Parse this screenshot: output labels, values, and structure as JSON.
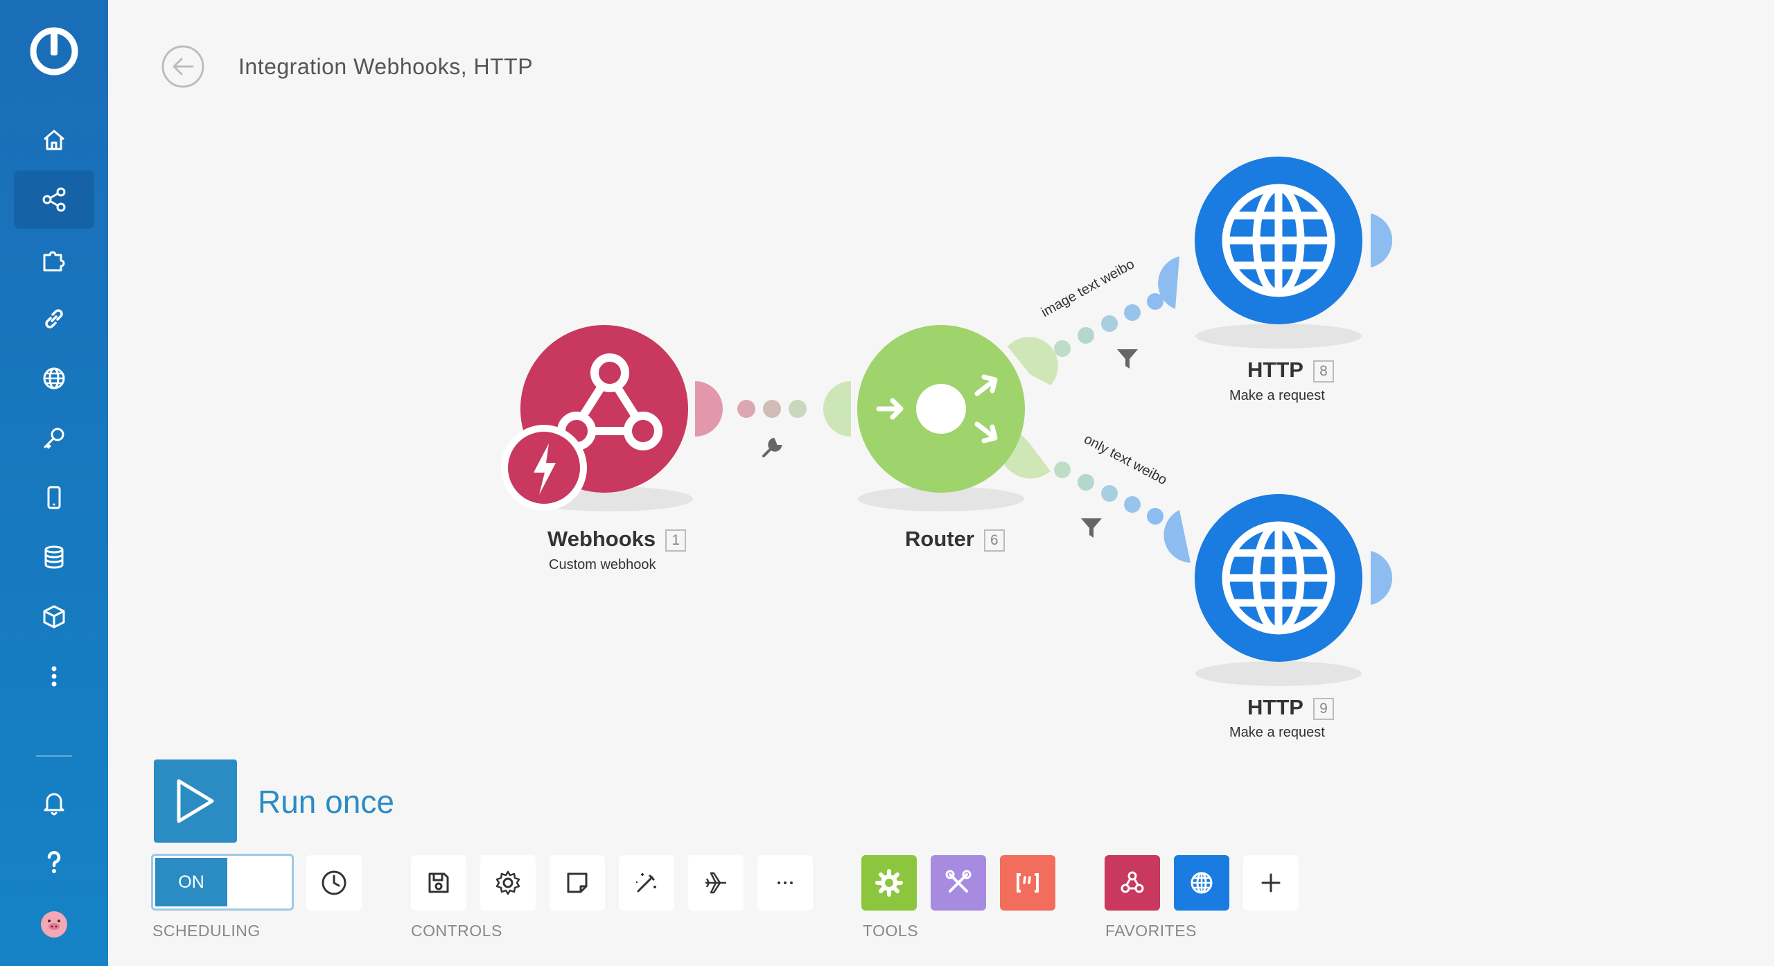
{
  "header": {
    "title": "Integration Webhooks, HTTP"
  },
  "sidebar": {
    "items": [
      {
        "icon": "home-icon"
      },
      {
        "icon": "share-icon"
      },
      {
        "icon": "puzzle-icon"
      },
      {
        "icon": "link-icon"
      },
      {
        "icon": "globe-icon"
      },
      {
        "icon": "key-icon"
      },
      {
        "icon": "mobile-icon"
      },
      {
        "icon": "database-icon"
      },
      {
        "icon": "cube-icon"
      },
      {
        "icon": "more-vertical-icon"
      },
      {
        "icon": "bell-icon"
      },
      {
        "icon": "help-icon"
      },
      {
        "icon": "avatar-icon"
      }
    ]
  },
  "nodes": {
    "webhooks": {
      "name": "Webhooks",
      "id": "1",
      "subtitle": "Custom webhook",
      "color": "#c8385f"
    },
    "router": {
      "name": "Router",
      "id": "6",
      "color": "#9fd36b"
    },
    "http_top": {
      "name": "HTTP",
      "id": "8",
      "subtitle": "Make a request",
      "color": "#1a7be0"
    },
    "http_bottom": {
      "name": "HTTP",
      "id": "9",
      "subtitle": "Make a request",
      "color": "#1a7be0"
    }
  },
  "routes": {
    "top": "image text weibo",
    "bottom": "only text weibo"
  },
  "controls": {
    "run_once": "Run once",
    "scheduling_on": "ON",
    "sections": {
      "scheduling": "SCHEDULING",
      "controls": "CONTROLS",
      "tools": "TOOLS",
      "favorites": "FAVORITES"
    }
  },
  "colors": {
    "sidebar": "#1a6db7",
    "accent": "#2b8cc4",
    "tools_green": "#8cc63f",
    "tools_purple": "#a78be0",
    "tools_red": "#f26d5b",
    "fav_pink": "#c8385f",
    "fav_blue": "#1a7be0"
  }
}
